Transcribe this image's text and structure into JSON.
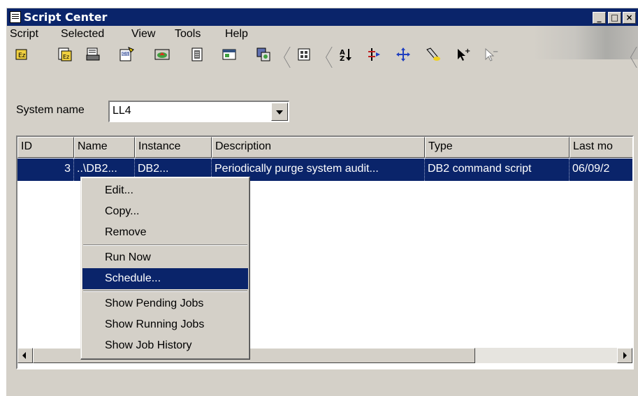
{
  "window": {
    "title": "Script Center",
    "minimize_glyph": "_",
    "maximize_glyph": "□",
    "close_glyph": "×"
  },
  "menubar": [
    "Script",
    "Selected",
    "View",
    "Tools",
    "Help"
  ],
  "toolbar": {
    "tools": [
      {
        "name": "new-script-icon",
        "color": "#c8a000"
      },
      {
        "name": "open-script-icon",
        "color": "#c8a000"
      },
      {
        "name": "scheduler-icon",
        "color": "#303030"
      },
      {
        "name": "command-editor-icon",
        "color": "#6080c0"
      },
      {
        "name": "task-status-icon",
        "color": "#d02020"
      },
      {
        "name": "journal-icon",
        "color": "#404040"
      },
      {
        "name": "window-icon",
        "color": "#208040"
      },
      {
        "name": "tools-settings-icon",
        "color": "#5060a0"
      },
      {
        "name": "customize-columns-icon",
        "color": "#404040"
      },
      {
        "name": "sort-icon",
        "color": "#000000"
      },
      {
        "name": "filter-icon",
        "color": "#c02020"
      },
      {
        "name": "find-icon",
        "color": "#2040c0"
      },
      {
        "name": "highlight-icon",
        "color": "#d0b000"
      },
      {
        "name": "select-all-icon",
        "color": "#000000"
      },
      {
        "name": "deselect-all-icon",
        "color": "#808080"
      }
    ]
  },
  "system_name": {
    "label": "System name",
    "value": "LL4"
  },
  "table": {
    "columns": [
      "ID",
      "Name",
      "Instance",
      "Description",
      "Type",
      "Last mo"
    ],
    "rows": [
      {
        "id": "3",
        "name": "..\\DB2...",
        "instance": "DB2...",
        "description": "Periodically purge system audit...",
        "type": "DB2 command script",
        "last_modified": "06/09/2"
      }
    ]
  },
  "context_menu": {
    "group1": [
      "Edit...",
      "Copy...",
      "Remove"
    ],
    "group2": [
      "Run Now",
      "Schedule..."
    ],
    "group3": [
      "Show Pending Jobs",
      "Show Running Jobs",
      "Show Job History"
    ],
    "active_item": "Schedule..."
  },
  "colors": {
    "titlebar": "#0a246a",
    "selection": "#0a246a",
    "face": "#d4d0c8"
  }
}
